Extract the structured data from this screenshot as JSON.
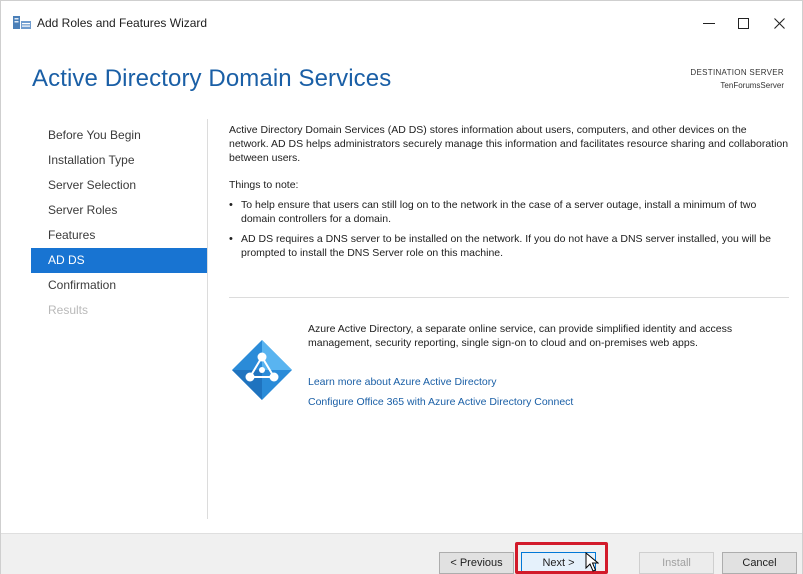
{
  "window": {
    "title": "Add Roles and Features Wizard",
    "minimize_glyph": "—",
    "maximize_glyph": "☐",
    "close_glyph": "✕"
  },
  "header": {
    "heading": "Active Directory Domain Services",
    "destination_label": "DESTINATION SERVER",
    "destination_server": "TenForumsServer"
  },
  "nav": {
    "items": [
      {
        "label": "Before You Begin",
        "state": "normal"
      },
      {
        "label": "Installation Type",
        "state": "normal"
      },
      {
        "label": "Server Selection",
        "state": "normal"
      },
      {
        "label": "Server Roles",
        "state": "normal"
      },
      {
        "label": "Features",
        "state": "normal"
      },
      {
        "label": "AD DS",
        "state": "active"
      },
      {
        "label": "Confirmation",
        "state": "normal"
      },
      {
        "label": "Results",
        "state": "disabled"
      }
    ]
  },
  "content": {
    "intro": "Active Directory Domain Services (AD DS) stores information about users, computers, and other devices on the network.  AD DS helps administrators securely manage this information and facilitates resource sharing and collaboration between users.",
    "things_to_note": "Things to note:",
    "bullets": [
      "To help ensure that users can still log on to the network in the case of a server outage, install a minimum of two domain controllers for a domain.",
      "AD DS requires a DNS server to be installed on the network.  If you do not have a DNS server installed, you will be prompted to install the DNS Server role on this machine."
    ],
    "azure_text": "Azure Active Directory, a separate online service, can provide simplified identity and access management, security reporting, single sign-on to cloud and on-premises web apps.",
    "link_learn_more": "Learn more about Azure Active Directory",
    "link_configure": "Configure Office 365 with Azure Active Directory Connect"
  },
  "footer": {
    "previous": "< Previous",
    "next": "Next >",
    "install": "Install",
    "cancel": "Cancel"
  },
  "colors": {
    "heading": "#1a5fa6",
    "nav_active_bg": "#1874d2",
    "azure_icon": "#2a8bd8",
    "highlight": "#d21a2a"
  }
}
